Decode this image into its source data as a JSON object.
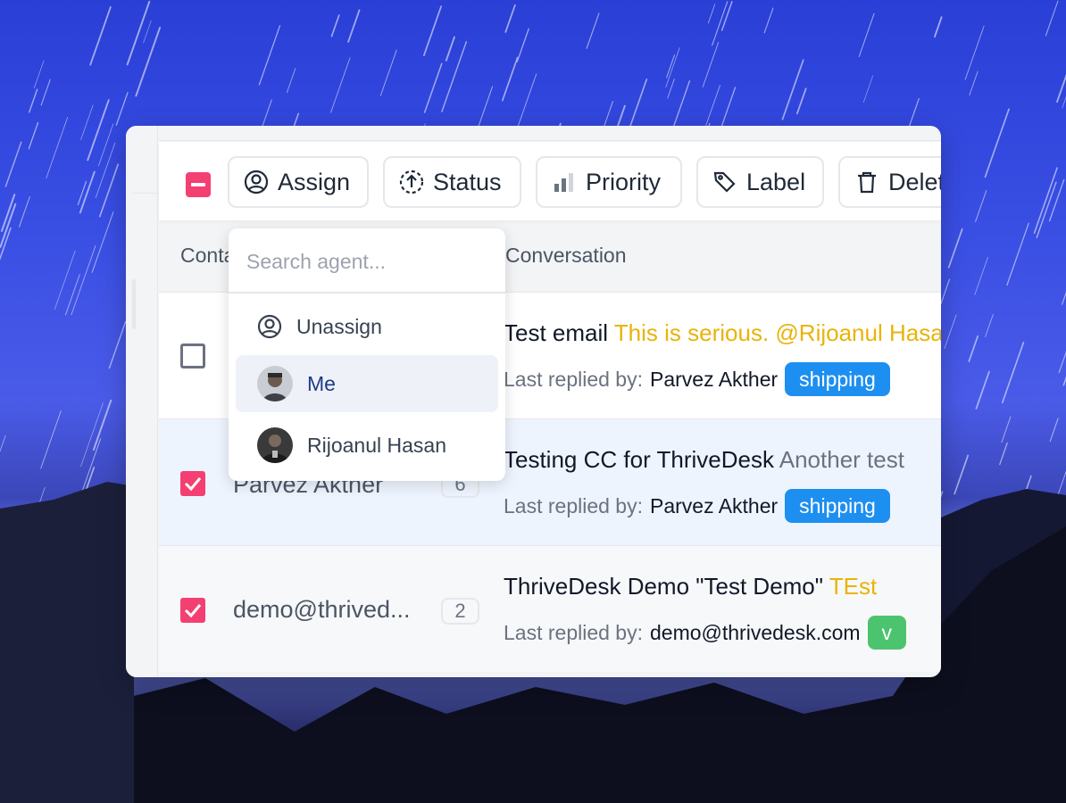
{
  "toolbar": {
    "assign_label": "Assign",
    "status_label": "Status",
    "priority_label": "Priority",
    "label_label": "Label",
    "delete_label": "Delete"
  },
  "table": {
    "columns": {
      "contact": "Contact",
      "conversation": "Conversation"
    },
    "rows": [
      {
        "contact": "",
        "count": "",
        "subject": "Test email ",
        "preview": "This is serious. @Rijoanul Hasan",
        "last_replied_prefix": "Last replied by:",
        "last_replied_by": "Parvez Akther",
        "tag": "shipping",
        "selected": false
      },
      {
        "contact": "Parvez Akther",
        "count": "6",
        "subject": "Testing CC for ThriveDesk ",
        "preview": "Another test",
        "last_replied_prefix": "Last replied by:",
        "last_replied_by": "Parvez Akther",
        "tag": "shipping",
        "selected": true
      },
      {
        "contact": "demo@thrived...",
        "count": "2",
        "subject": "ThriveDesk Demo \"Test Demo\" ",
        "preview": "TEst",
        "last_replied_prefix": "Last replied by:",
        "last_replied_by": "demo@thrivedesk.com",
        "tag": "v",
        "selected": true
      }
    ]
  },
  "assign_dropdown": {
    "search_placeholder": "Search agent...",
    "items": [
      {
        "label": "Unassign",
        "icon": "user-circle-icon"
      },
      {
        "label": "Me",
        "icon": "avatar",
        "highlighted": true
      },
      {
        "label": "Rijoanul Hasan",
        "icon": "avatar"
      }
    ]
  },
  "colors": {
    "accent_pink": "#f43f72",
    "tag_blue": "#1d8ff0",
    "tag_green": "#4cc36f",
    "preview_yellow": "#eab308"
  }
}
